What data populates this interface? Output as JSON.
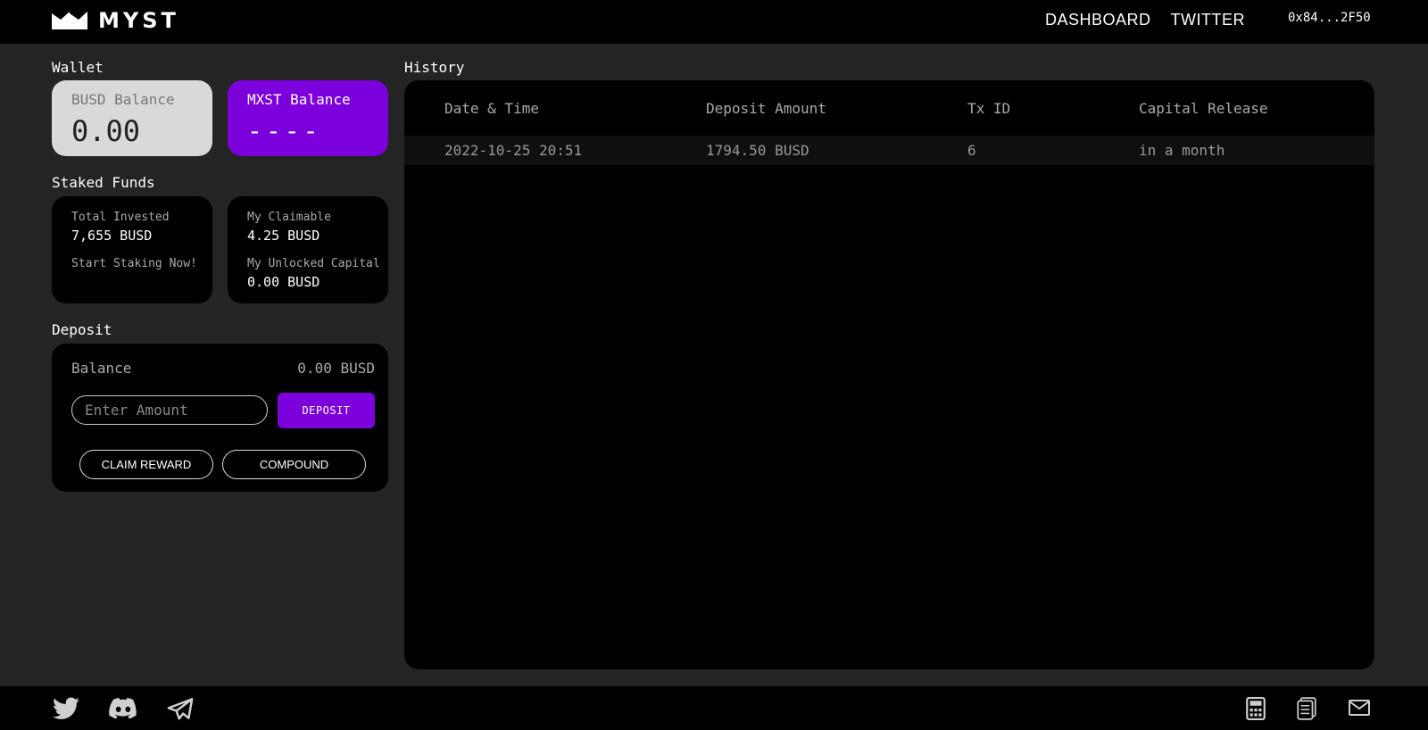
{
  "header": {
    "brand": "MYST",
    "nav": [
      "DASHBOARD",
      "TWITTER"
    ],
    "wallet_address": "0x84...2F50"
  },
  "wallet": {
    "section_title": "Wallet",
    "busd": {
      "label": "BUSD Balance",
      "value": "0.00"
    },
    "mxst": {
      "label": "MXST Balance",
      "value": "----"
    }
  },
  "staked": {
    "section_title": "Staked Funds",
    "total_invested_label": "Total Invested",
    "total_invested_value": "7,655 BUSD",
    "cta": "Start Staking Now!",
    "claimable_label": "My Claimable",
    "claimable_value": "4.25 BUSD",
    "unlocked_label": "My Unlocked Capital",
    "unlocked_value": "0.00 BUSD"
  },
  "deposit": {
    "section_title": "Deposit",
    "balance_label": "Balance",
    "balance_value": "0.00 BUSD",
    "amount_placeholder": "Enter Amount",
    "deposit_button": "DEPOSIT",
    "claim_button": "CLAIM REWARD",
    "compound_button": "COMPOUND"
  },
  "history": {
    "section_title": "History",
    "columns": [
      "Date & Time",
      "Deposit Amount",
      "Tx ID",
      "Capital Release"
    ],
    "rows": [
      [
        "2022-10-25 20:51",
        "1794.50 BUSD",
        "6",
        "in a month"
      ]
    ]
  },
  "footer": {
    "icons": [
      "twitter-icon",
      "discord-icon",
      "telegram-icon",
      "calculator-icon",
      "document-icon",
      "mail-icon"
    ]
  },
  "colors": {
    "accent": "#7c00dc",
    "background": "#242424",
    "panel": "#000000"
  }
}
